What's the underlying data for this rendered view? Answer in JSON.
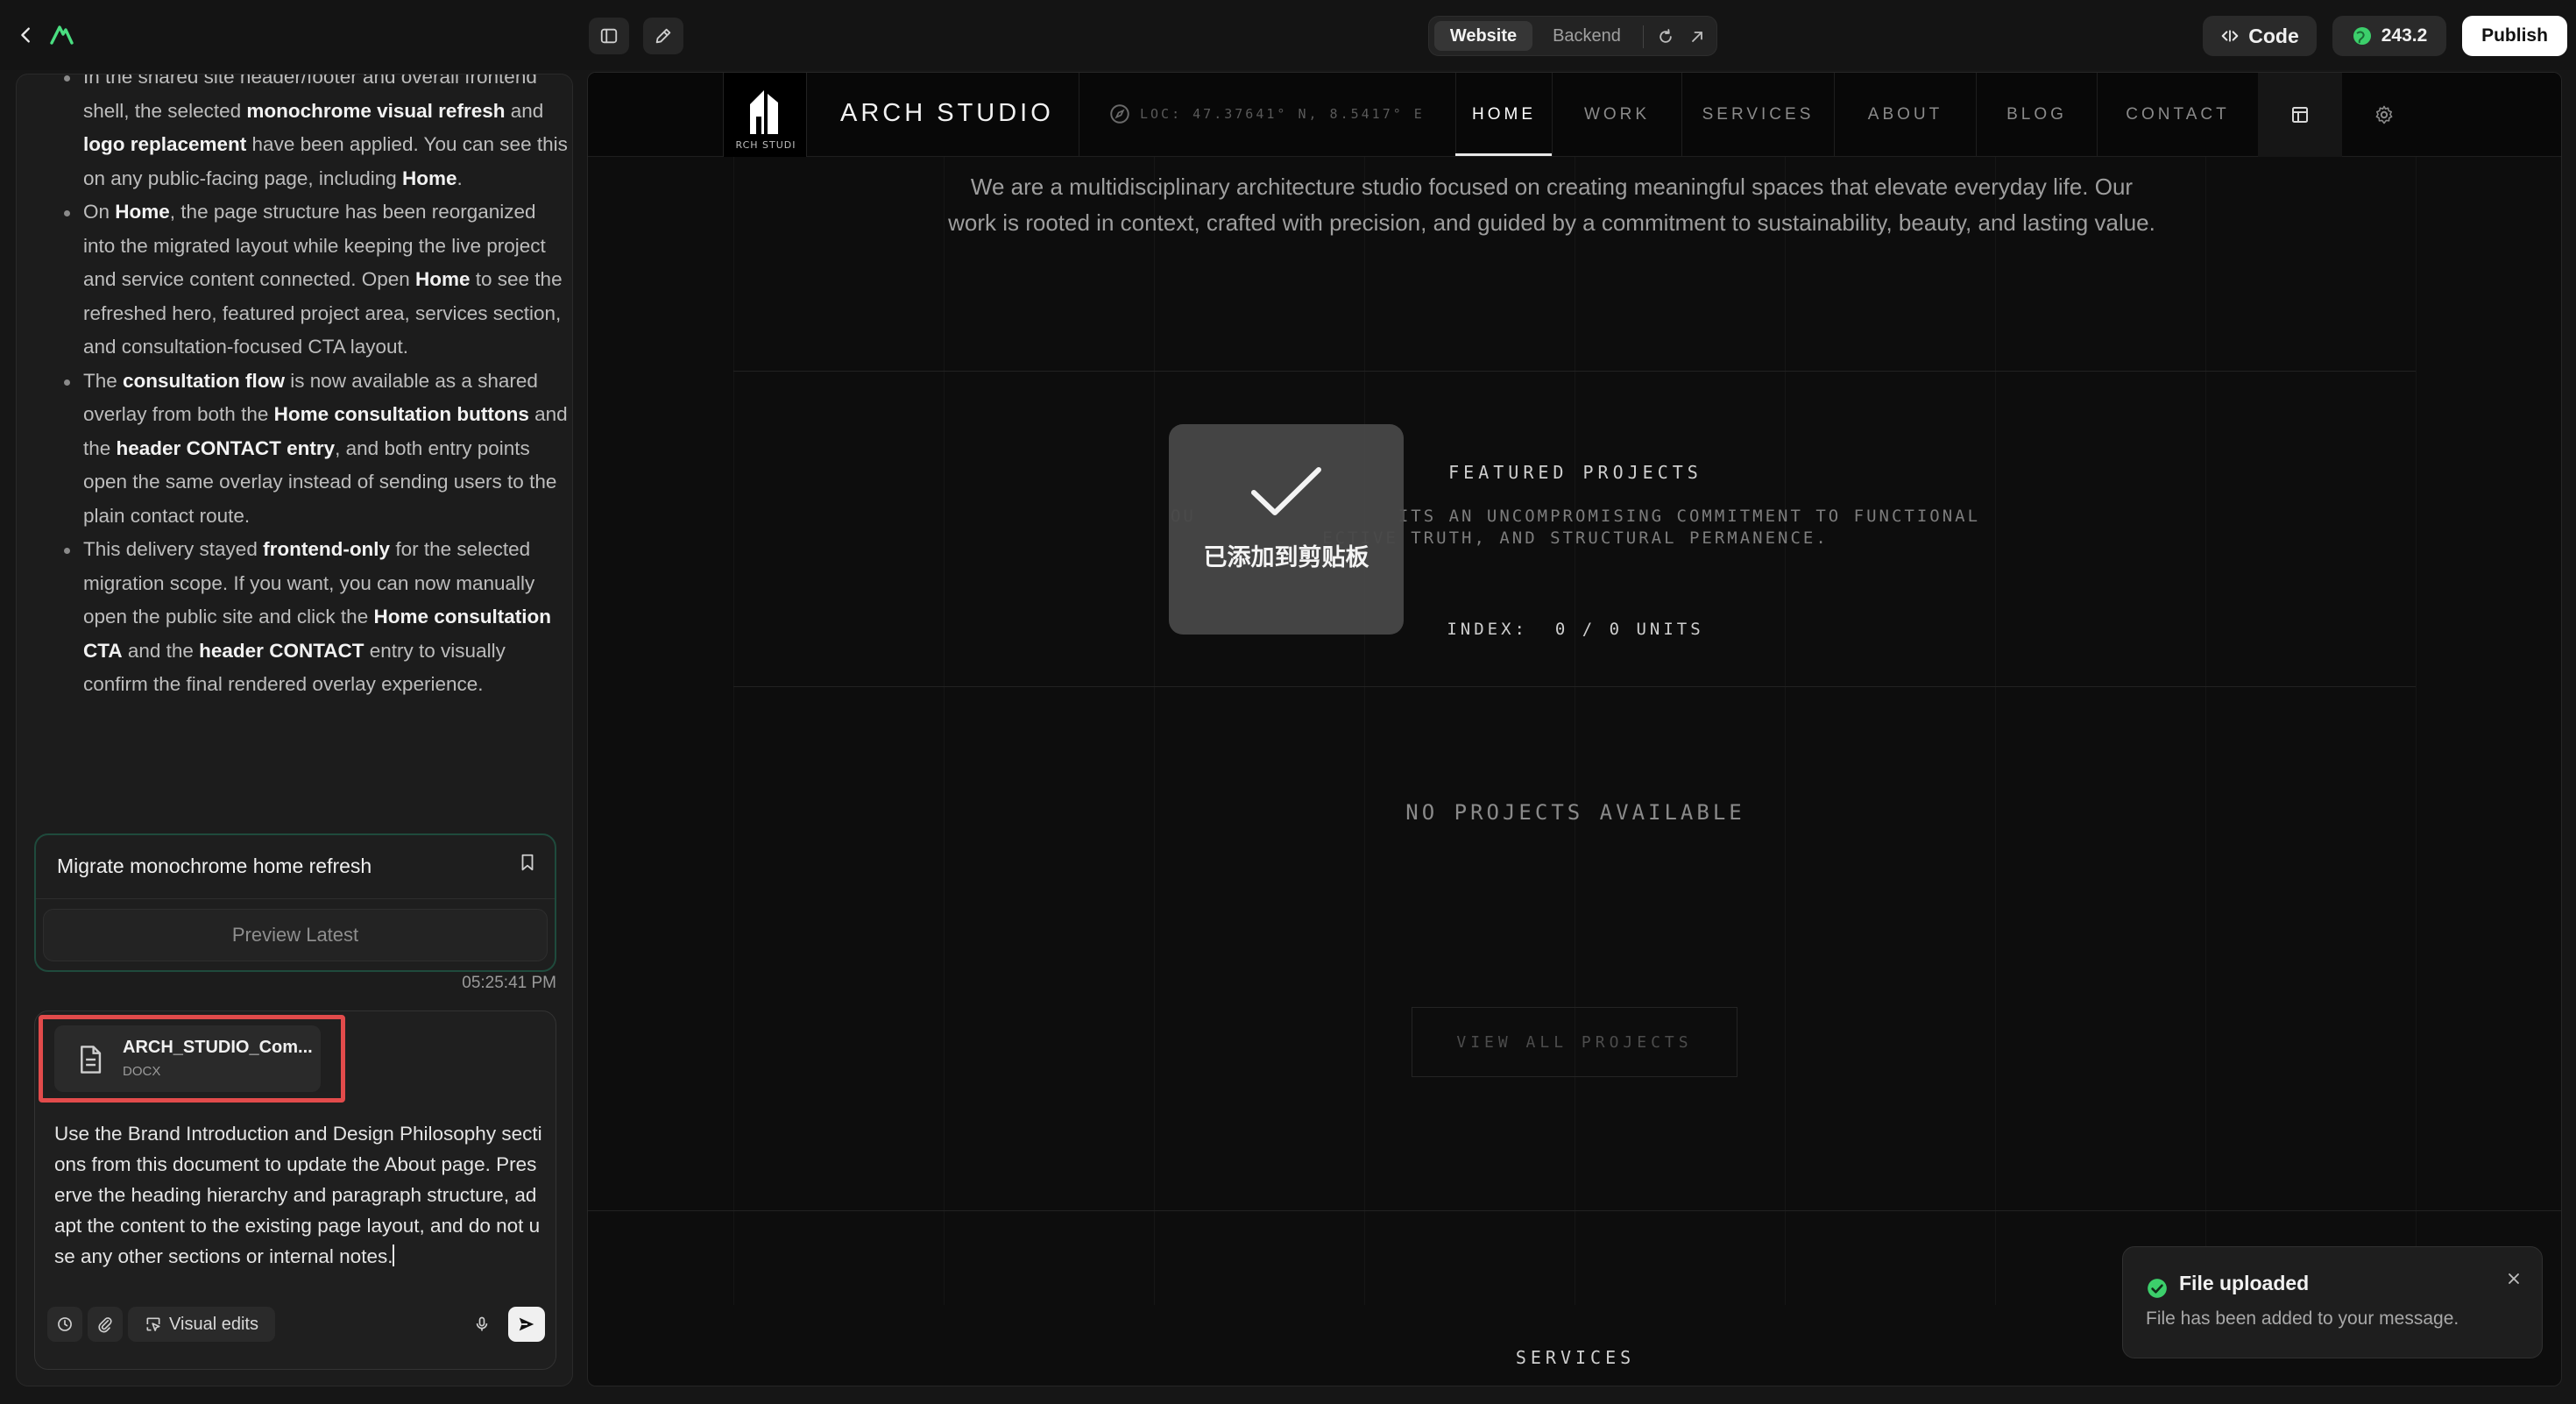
{
  "topbar": {
    "tabs": {
      "website": "Website",
      "backend": "Backend"
    },
    "code_label": "Code",
    "credits": "243.2",
    "publish_label": "Publish"
  },
  "chat": {
    "items": [
      {
        "lines": [
          "In the shared site header/footer and overall",
          "frontend shell, the selected monochrome visual",
          "refresh and logo replacement have been applied.",
          "You can see this on any public-facing page,",
          "including Home."
        ]
      }
    ],
    "item1": {
      "p1": "In the shared site header/footer and overall frontend shell, the selected ",
      "b1": "monochrome visual refresh",
      "p2": " and ",
      "b2": "logo replacement",
      "p3": " have been applied. You can see this on any public-facing page, including ",
      "b3": "Home",
      "p4": "."
    },
    "item2": {
      "p1": "On ",
      "b1": "Home",
      "p2": ", the page structure has been reorganized into the migrated layout while keeping the live project and service content connected. Open ",
      "b2": "Home",
      "p3": " to see the refreshed hero, featured project area, services section, and consultation-focused CTA layout."
    },
    "item3": {
      "p1": "The ",
      "b1": "consultation flow",
      "p2": " is now available as a shared overlay from both the ",
      "b2": "Home consultation buttons",
      "p3": " and the ",
      "b3": "header CONTACT entry",
      "p4": ", and both entry points open the same overlay instead of sending users to the plain contact route."
    },
    "item4": {
      "p1": "This delivery stayed ",
      "b1": "frontend-only",
      "p2": " for the selected migration scope. If you want, you can now manually open the public site and click the ",
      "b2": "Home consultation CTA",
      "p3": " and the ",
      "b3": "header CONTACT",
      "p4": " entry to visually confirm the final rendered overlay experience."
    },
    "task_card": {
      "title": "Migrate monochrome home refresh",
      "preview_label": "Preview Latest",
      "time": "05:25:41 PM"
    },
    "composer": {
      "attachment": {
        "name": "ARCH_STUDIO_Com...",
        "type": "DOCX"
      },
      "text": "Use the Brand Introduction and Design Philosophy sections from this document to update the About page. Preserve the heading hierarchy and paragraph structure, adapt the content to the existing page layout, and do not use any other sections or internal notes.",
      "visual_edits_label": "Visual edits"
    }
  },
  "site": {
    "name": "ARCH STUDIO",
    "logo_text": "RCH STUDI",
    "location": "LOC: 47.37641° N, 8.5417° E",
    "nav": [
      "HOME",
      "WORK",
      "SERVICES",
      "ABOUT",
      "BLOG",
      "CONTACT"
    ],
    "active_nav": "HOME",
    "intro": "We are a multidisciplinary architecture studio focused on creating meaningful spaces that elevate everyday life. Our work is rooted in context, crafted with precision, and guided by a commitment to sustainability, beauty, and lasting value.",
    "featured_title": "FEATURED PROJECTS",
    "featured_desc_line1": "OU                ITS AN UNCOMPROMISING COMMITMENT TO FUNCTIONAL",
    "featured_desc_line2": "ECTIVE TRUTH, AND STRUCTURAL PERMANENCE.",
    "index": "INDEX:  0 / 0 UNITS",
    "no_projects": "NO PROJECTS AVAILABLE",
    "view_all": "VIEW ALL PROJECTS",
    "services_title": "SERVICES"
  },
  "clipboard_toast": {
    "text": "已添加到剪贴板"
  },
  "upload_toast": {
    "title": "File uploaded",
    "description": "File has been added to your message."
  },
  "colors": {
    "accent_green": "#3ccf6b",
    "highlight_red": "#e24b4b"
  }
}
